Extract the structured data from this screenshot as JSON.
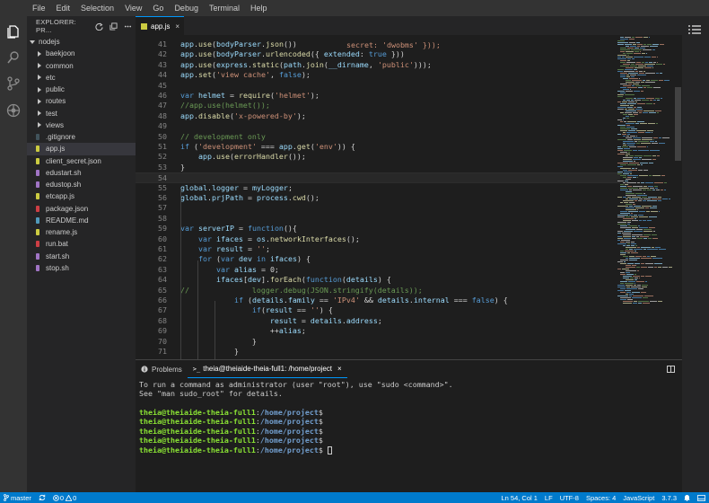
{
  "menu": [
    "File",
    "Edit",
    "Selection",
    "View",
    "Go",
    "Debug",
    "Terminal",
    "Help"
  ],
  "explorer": {
    "title": "EXPLORER: PR...",
    "root": "nodejs",
    "items": [
      {
        "label": "baekjoon",
        "type": "folder",
        "color": "#c5c5c5"
      },
      {
        "label": "common",
        "type": "folder",
        "color": "#c5c5c5"
      },
      {
        "label": "etc",
        "type": "folder",
        "color": "#c5c5c5"
      },
      {
        "label": "public",
        "type": "folder",
        "color": "#c5c5c5"
      },
      {
        "label": "routes",
        "type": "folder",
        "color": "#c5c5c5"
      },
      {
        "label": "test",
        "type": "folder",
        "color": "#c5c5c5"
      },
      {
        "label": "views",
        "type": "folder",
        "color": "#c5c5c5"
      },
      {
        "label": ".gitignore",
        "type": "file",
        "color": "#41535b"
      },
      {
        "label": "app.js",
        "type": "file",
        "color": "#cbcb41"
      },
      {
        "label": "client_secret.json",
        "type": "file",
        "color": "#cbcb41"
      },
      {
        "label": "edustart.sh",
        "type": "file",
        "color": "#a074c4"
      },
      {
        "label": "edustop.sh",
        "type": "file",
        "color": "#a074c4"
      },
      {
        "label": "etcapp.js",
        "type": "file",
        "color": "#cbcb41"
      },
      {
        "label": "package.json",
        "type": "file",
        "color": "#cc3e44"
      },
      {
        "label": "README.md",
        "type": "file",
        "color": "#519aba"
      },
      {
        "label": "rename.js",
        "type": "file",
        "color": "#cbcb41"
      },
      {
        "label": "run.bat",
        "type": "file",
        "color": "#cc3e44"
      },
      {
        "label": "start.sh",
        "type": "file",
        "color": "#a074c4"
      },
      {
        "label": "stop.sh",
        "type": "file",
        "color": "#a074c4"
      }
    ],
    "selected": "app.js"
  },
  "editor": {
    "tab": "app.js",
    "tab_close": "×",
    "partial_line": "secret: 'dwobms' }));",
    "lines": [
      {
        "n": "41",
        "code": "app.use(bodyParser.json())"
      },
      {
        "n": "42",
        "code": "app.use(bodyParser.urlencoded({ extended: true }))"
      },
      {
        "n": "43",
        "code": "app.use(express.static(path.join(__dirname, 'public')));"
      },
      {
        "n": "44",
        "code": "app.set('view cache', false);"
      },
      {
        "n": "45",
        "code": ""
      },
      {
        "n": "46",
        "code": "var helmet = require('helmet');"
      },
      {
        "n": "47",
        "code": "//app.use(helmet());"
      },
      {
        "n": "48",
        "code": "app.disable('x-powered-by');"
      },
      {
        "n": "49",
        "code": ""
      },
      {
        "n": "50",
        "code": "// development only"
      },
      {
        "n": "51",
        "code": "if ('development' === app.get('env')) {"
      },
      {
        "n": "52",
        "code": "    app.use(errorHandler());"
      },
      {
        "n": "53",
        "code": "}"
      },
      {
        "n": "54",
        "code": ""
      },
      {
        "n": "55",
        "code": "global.logger = myLogger;"
      },
      {
        "n": "56",
        "code": "global.prjPath = process.cwd();"
      },
      {
        "n": "57",
        "code": ""
      },
      {
        "n": "58",
        "code": ""
      },
      {
        "n": "59",
        "code": "var serverIP = function(){"
      },
      {
        "n": "60",
        "code": "    var ifaces = os.networkInterfaces();"
      },
      {
        "n": "61",
        "code": "    var result = '';"
      },
      {
        "n": "62",
        "code": "    for (var dev in ifaces) {"
      },
      {
        "n": "63",
        "code": "        var alias = 0;"
      },
      {
        "n": "64",
        "code": "        ifaces[dev].forEach(function(details) {"
      },
      {
        "n": "65",
        "code": "//              logger.debug(JSON.stringify(details));"
      },
      {
        "n": "66",
        "code": "            if (details.family == 'IPv4' && details.internal === false) {"
      },
      {
        "n": "67",
        "code": "                if(result == '') {"
      },
      {
        "n": "68",
        "code": "                    result = details.address;"
      },
      {
        "n": "69",
        "code": "                    ++alias;"
      },
      {
        "n": "70",
        "code": "                }"
      },
      {
        "n": "71",
        "code": "            }"
      }
    ]
  },
  "panel": {
    "problems_tab": "Problems",
    "terminal_tab": "theia@theiaide-theia-full1: /home/project",
    "terminal_close": "×",
    "terminal_lines": [
      "To run a command as administrator (user \"root\"), use \"sudo <command>\".",
      "See \"man sudo_root\" for details."
    ],
    "prompt_user": "theia@theiaide-theia-full1",
    "prompt_path": "/home/project",
    "prompt_suffix": "$"
  },
  "status": {
    "branch": "master",
    "errors": "0",
    "warnings": "0",
    "position": "Ln 54, Col 1",
    "eol": "LF",
    "encoding": "UTF-8",
    "indent": "Spaces: 4",
    "language": "JavaScript",
    "version": "3.7.3"
  }
}
